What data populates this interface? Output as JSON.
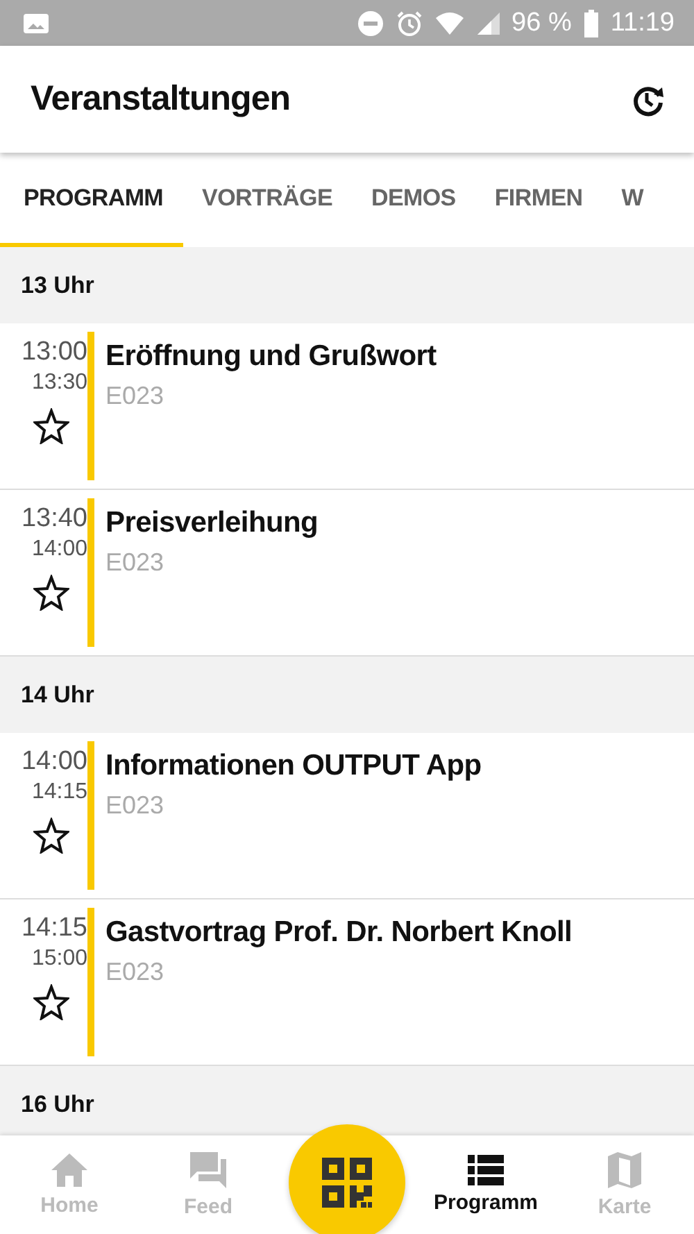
{
  "status_bar": {
    "battery": "96 %",
    "time": "11:19"
  },
  "app_bar": {
    "title": "Veranstaltungen"
  },
  "tabs": [
    {
      "label": "PROGRAMM",
      "selected": true
    },
    {
      "label": "VORTRÄGE",
      "selected": false
    },
    {
      "label": "DEMOS",
      "selected": false
    },
    {
      "label": "FIRMEN",
      "selected": false
    },
    {
      "label": "W",
      "selected": false
    }
  ],
  "sections": [
    {
      "heading": "13 Uhr",
      "events": [
        {
          "start": "13:00",
          "end": "13:30",
          "title": "Eröffnung und Grußwort",
          "room": "E023",
          "starred": false
        },
        {
          "start": "13:40",
          "end": "14:00",
          "title": "Preisverleihung",
          "room": "E023",
          "starred": false
        }
      ]
    },
    {
      "heading": "14 Uhr",
      "events": [
        {
          "start": "14:00",
          "end": "14:15",
          "title": "Informationen OUTPUT App",
          "room": "E023",
          "starred": false
        },
        {
          "start": "14:15",
          "end": "15:00",
          "title": "Gastvortrag Prof. Dr. Norbert Knoll",
          "room": "E023",
          "starred": false
        }
      ]
    },
    {
      "heading": "16 Uhr"
    }
  ],
  "bottom_nav": [
    {
      "kind": "home",
      "label": "Home",
      "selected": false
    },
    {
      "kind": "feed",
      "label": "Feed",
      "selected": false
    },
    {
      "kind": "scan",
      "selected": false
    },
    {
      "kind": "program",
      "label": "Programm",
      "selected": true
    },
    {
      "kind": "map",
      "label": "Karte",
      "selected": false
    }
  ]
}
